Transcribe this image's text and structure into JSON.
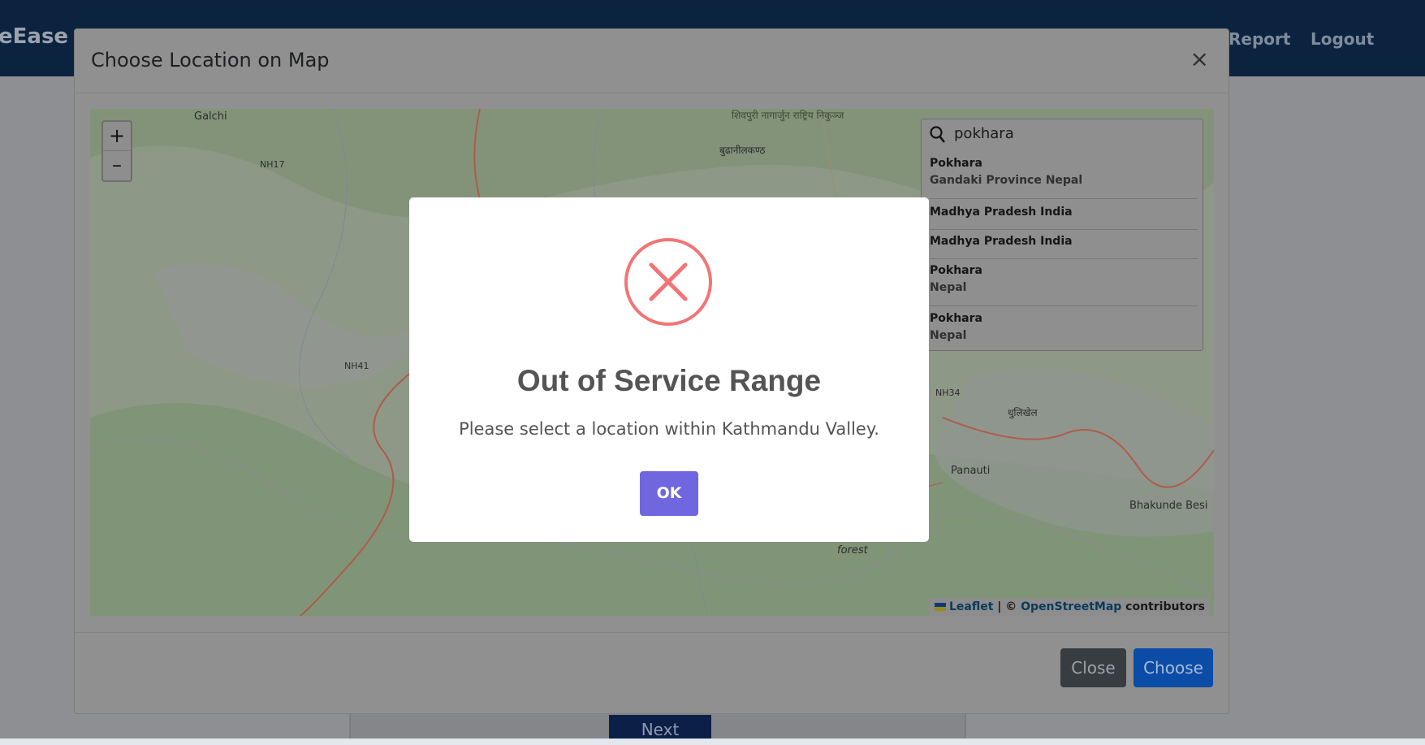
{
  "navbar": {
    "brand": "eEase",
    "links": [
      "Report",
      "Logout"
    ]
  },
  "page": {
    "next_label": "Next"
  },
  "modal": {
    "title": "Choose Location on Map",
    "close_glyph": "×",
    "zoom_in": "+",
    "zoom_out": "–",
    "search": {
      "value": "pokhara",
      "results": [
        {
          "name": "Pokhara",
          "sub": "Gandaki Province Nepal"
        },
        {
          "name": "Madhya Pradesh India",
          "sub": ""
        },
        {
          "name": "Madhya Pradesh India",
          "sub": ""
        },
        {
          "name": "Pokhara",
          "sub": "Nepal"
        },
        {
          "name": "Pokhara",
          "sub": "Nepal"
        }
      ]
    },
    "map_labels": [
      "Galchi",
      "NH17",
      "NH41",
      "NH34",
      "शिवपुरी नागार्जुन राष्ट्रिय निकुञ्ज",
      "बुढानीलकण्ठ",
      "Panauti",
      "धुलिखेल",
      "Bhakunde Besi",
      "forest"
    ],
    "attribution": {
      "leaflet": "Leaflet",
      "separator": " | © ",
      "osm": "OpenStreetMap",
      "suffix": " contributors"
    },
    "footer": {
      "close_label": "Close",
      "choose_label": "Choose"
    }
  },
  "alert": {
    "icon": "error-x-icon",
    "title": "Out of Service Range",
    "text": "Please select a location within Kathmandu Valley.",
    "ok_label": "OK",
    "colors": {
      "icon": "#f27474",
      "button": "#7066e0"
    }
  }
}
